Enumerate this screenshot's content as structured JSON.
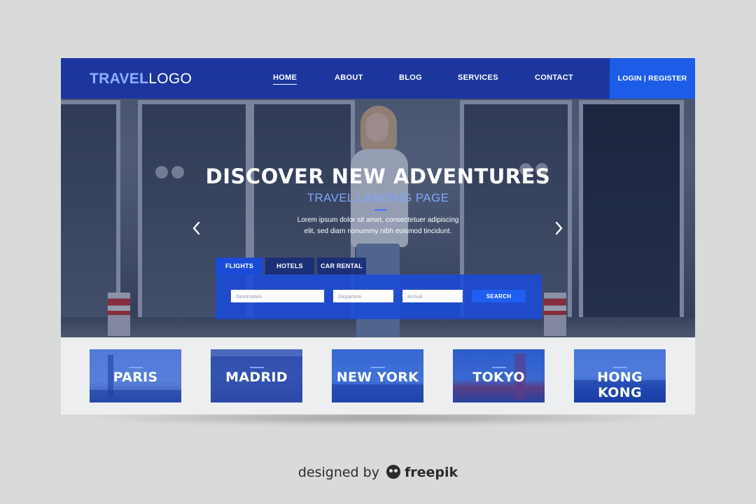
{
  "nav": {
    "logo_primary": "TRAVEL",
    "logo_secondary": "LOGO",
    "links": [
      "HOME",
      "ABOUT",
      "BLOG",
      "SERVICES",
      "CONTACT"
    ],
    "active_link": "HOME",
    "login_label": "LOGIN | REGISTER"
  },
  "hero": {
    "title": "DISCOVER NEW ADVENTURES",
    "subtitle": "TRAVEL LANDING PAGE",
    "body_line1": "Lorem ipsum dolor sit amet, consectetuer adipiscing",
    "body_line2": "elit, sed diam nonummy nibh euismod tincidunt.",
    "prev_icon": "chevron-left-icon",
    "next_icon": "chevron-right-icon"
  },
  "search": {
    "tabs": [
      "FLIGHTS",
      "HOTELS",
      "CAR RENTAL"
    ],
    "active_tab": "FLIGHTS",
    "destination_placeholder": "Destination",
    "departure_placeholder": "Departure",
    "arrival_placeholder": "Arrival",
    "button_label": "SEARCH"
  },
  "destinations": [
    "PARIS",
    "MADRID",
    "NEW YORK",
    "TOKYO",
    "HONG KONG"
  ],
  "credit": {
    "prefix": "designed by",
    "brand": "freepik",
    "icon": "freepik-mascot-icon"
  },
  "colors": {
    "accent": "#1d5ce6",
    "nav": "#1330aa",
    "subtitle": "#7ea6ff",
    "background": "#d9dbda"
  }
}
